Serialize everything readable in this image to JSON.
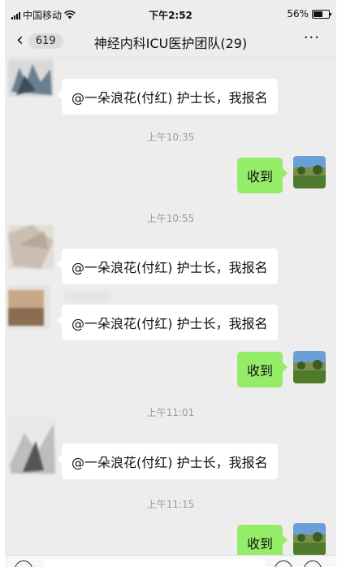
{
  "status_bar": {
    "carrier": "中国移动",
    "time": "下午2:52",
    "battery_percent": "56%",
    "battery_level": 0.56,
    "icons": [
      "signal-icon",
      "wifi-icon",
      "battery-icon"
    ]
  },
  "nav": {
    "unread_count": "619",
    "title": "神经内科ICU医护团队(29)",
    "more_label": "···"
  },
  "messages": {
    "m1_text": "@一朵浪花(付红) 护士长，我报名",
    "ts1": "上午10:35",
    "r1_text": "收到",
    "ts2": "上午10:55",
    "m2_text": "@一朵浪花(付红) 护士长，我报名",
    "m3_text": "@一朵浪花(付红) 护士长，我报名",
    "r2_text": "收到",
    "ts3": "上午11:01",
    "m4_text": "@一朵浪花(付红) 护士长，我报名",
    "ts4": "上午11:15",
    "r3_text": "收到"
  },
  "colors": {
    "chat_background": "#ededed",
    "sent_bubble": "#95ec69",
    "received_bubble": "#ffffff",
    "timestamp_text": "#9b9b9b"
  }
}
